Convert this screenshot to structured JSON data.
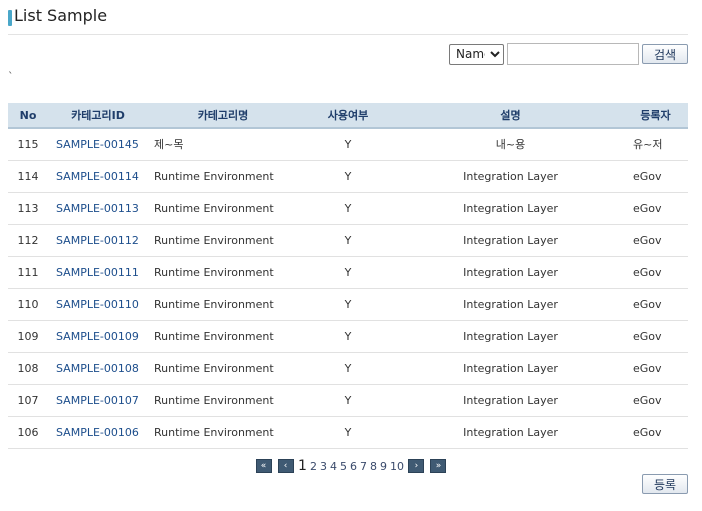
{
  "page": {
    "title": "List Sample",
    "backtick": "`"
  },
  "search": {
    "select_value": "Name",
    "input_value": "",
    "button_label": "검색"
  },
  "table": {
    "headers": [
      "No",
      "카테고리ID",
      "카테고리명",
      "사용여부",
      "설명",
      "등록자"
    ],
    "rows": [
      [
        "115",
        "SAMPLE-00145",
        "제~목",
        "Y",
        "내~용",
        "유~저"
      ],
      [
        "114",
        "SAMPLE-00114",
        "Runtime Environment",
        "Y",
        "Integration Layer",
        "eGov"
      ],
      [
        "113",
        "SAMPLE-00113",
        "Runtime Environment",
        "Y",
        "Integration Layer",
        "eGov"
      ],
      [
        "112",
        "SAMPLE-00112",
        "Runtime Environment",
        "Y",
        "Integration Layer",
        "eGov"
      ],
      [
        "111",
        "SAMPLE-00111",
        "Runtime Environment",
        "Y",
        "Integration Layer",
        "eGov"
      ],
      [
        "110",
        "SAMPLE-00110",
        "Runtime Environment",
        "Y",
        "Integration Layer",
        "eGov"
      ],
      [
        "109",
        "SAMPLE-00109",
        "Runtime Environment",
        "Y",
        "Integration Layer",
        "eGov"
      ],
      [
        "108",
        "SAMPLE-00108",
        "Runtime Environment",
        "Y",
        "Integration Layer",
        "eGov"
      ],
      [
        "107",
        "SAMPLE-00107",
        "Runtime Environment",
        "Y",
        "Integration Layer",
        "eGov"
      ],
      [
        "106",
        "SAMPLE-00106",
        "Runtime Environment",
        "Y",
        "Integration Layer",
        "eGov"
      ]
    ]
  },
  "pagination": {
    "first": "«",
    "prev": "‹",
    "pages": [
      "1",
      "2",
      "3",
      "4",
      "5",
      "6",
      "7",
      "8",
      "9",
      "10"
    ],
    "current": "1",
    "next": "›",
    "last": "»"
  },
  "actions": {
    "register_label": "등록"
  },
  "colors": {
    "header_bg": "#d5e2ec",
    "header_text": "#1f3d6a",
    "id_link": "#1d4e8c",
    "title_accent": "#4aa7c9",
    "pager_button": "#3f5a73"
  }
}
